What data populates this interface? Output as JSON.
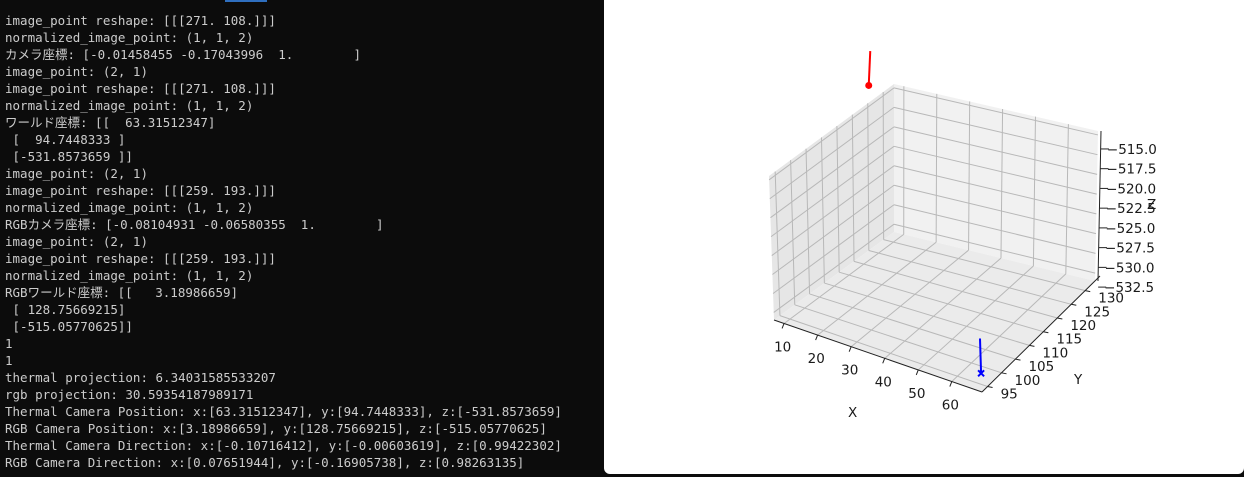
{
  "terminal": {
    "lines": [
      "image_point reshape: [[[271. 108.]]]",
      "normalized_image_point: (1, 1, 2)",
      "カメラ座標: [-0.01458455 -0.17043996  1.        ]",
      "image_point: (2, 1)",
      "image_point reshape: [[[271. 108.]]]",
      "normalized_image_point: (1, 1, 2)",
      "ワールド座標: [[  63.31512347]",
      " [  94.7448333 ]",
      " [-531.8573659 ]]",
      "image_point: (2, 1)",
      "image_point reshape: [[[259. 193.]]]",
      "normalized_image_point: (1, 1, 2)",
      "RGBカメラ座標: [-0.08104931 -0.06580355  1.        ]",
      "image_point: (2, 1)",
      "image_point reshape: [[[259. 193.]]]",
      "normalized_image_point: (1, 1, 2)",
      "RGBワールド座標: [[   3.18986659]",
      " [ 128.75669215]",
      " [-515.05770625]]",
      "1",
      "1",
      "thermal projection: 6.34031585533207",
      "rgb projection: 30.59354187989171",
      "Thermal Camera Position: x:[63.31512347], y:[94.7448333], z:[-531.8573659]",
      "RGB Camera Position: x:[3.18986659], y:[128.75669215], z:[-515.05770625]",
      "Thermal Camera Direction: x:[-0.10716412], y:[-0.00603619], z:[0.99422302]",
      "RGB Camera Direction: x:[0.07651944], y:[-0.16905738], z:[0.98263135]",
      "▯"
    ]
  },
  "chart_data": {
    "type": "scatter",
    "projection": "3d",
    "xlabel": "X",
    "ylabel": "Y",
    "zlabel": "Z",
    "x_ticks": [
      "10",
      "20",
      "30",
      "40",
      "50",
      "60"
    ],
    "y_ticks": [
      "95",
      "100",
      "105",
      "110",
      "115",
      "120",
      "125",
      "130"
    ],
    "z_ticks": [
      "−515.0",
      "−517.5",
      "−520.0",
      "−522.5",
      "−525.0",
      "−527.5",
      "−530.0",
      "−532.5"
    ],
    "grid": true,
    "series": [
      {
        "color": "#ff0000",
        "marker": "o",
        "points": [
          {
            "x": 3.18986659,
            "y": 128.75669215,
            "z": -515.05770625
          }
        ],
        "direction": {
          "x": 0.07651944,
          "y": -0.16905738,
          "z": 0.98263135
        }
      },
      {
        "color": "#0000ff",
        "marker": "x",
        "points": [
          {
            "x": 63.31512347,
            "y": 94.7448333,
            "z": -531.8573659
          }
        ],
        "direction": {
          "x": -0.10716412,
          "y": -0.00603619,
          "z": 0.99422302
        }
      }
    ]
  }
}
